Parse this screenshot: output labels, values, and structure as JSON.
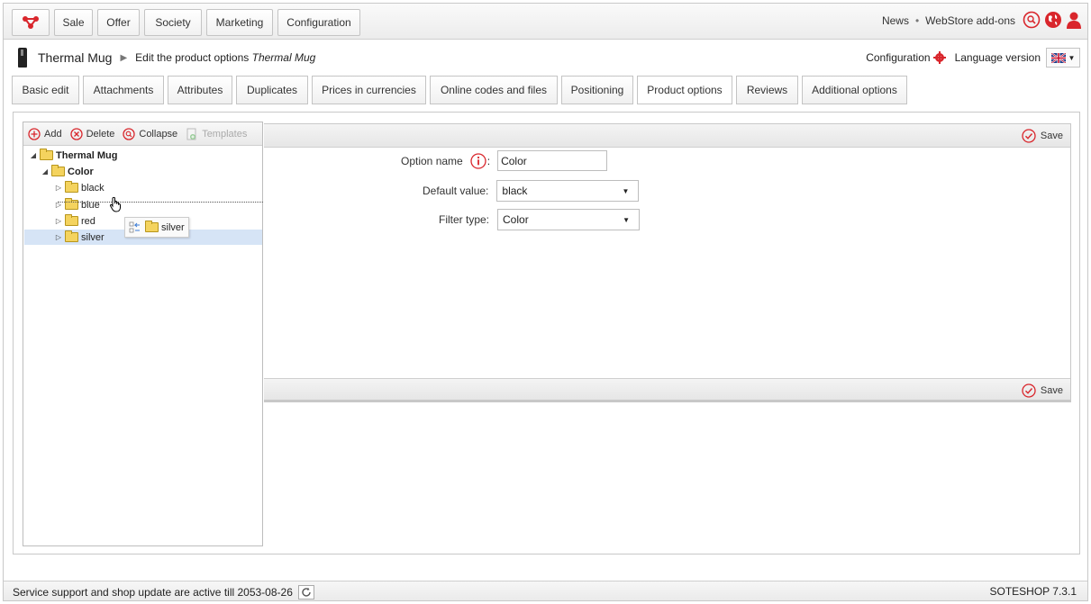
{
  "topnav": {
    "items": [
      "Sale",
      "Offer",
      "Society",
      "Marketing",
      "Configuration"
    ],
    "news": "News",
    "separator": "•",
    "addons": "WebStore add-ons"
  },
  "header": {
    "product": "Thermal Mug",
    "action": "Edit the product options",
    "action_target": "Thermal Mug",
    "configuration": "Configuration",
    "language_version": "Language version"
  },
  "tabs": [
    "Basic edit",
    "Attachments",
    "Attributes",
    "Duplicates",
    "Prices in currencies",
    "Online codes and files",
    "Positioning",
    "Product options",
    "Reviews",
    "Additional options"
  ],
  "active_tab": "Product options",
  "tree": {
    "toolbar": {
      "add": "Add",
      "delete": "Delete",
      "collapse": "Collapse",
      "templates": "Templates"
    },
    "root": "Thermal Mug",
    "group": "Color",
    "items": [
      "black",
      "blue",
      "red",
      "silver"
    ],
    "selected": "silver",
    "drag_label": "silver"
  },
  "form": {
    "save": "Save",
    "option_name_label": "Option name",
    "option_name_value": "Color",
    "default_value_label": "Default value:",
    "default_value": "black",
    "filter_type_label": "Filter type:",
    "filter_type": "Color",
    "colon": ":"
  },
  "status": {
    "support": "Service support and shop update are active till 2053-08-26",
    "version": "SOTESHOP 7.3.1"
  },
  "colors": {
    "accent": "#d9262c",
    "selected_row": "#d6e4f6"
  }
}
